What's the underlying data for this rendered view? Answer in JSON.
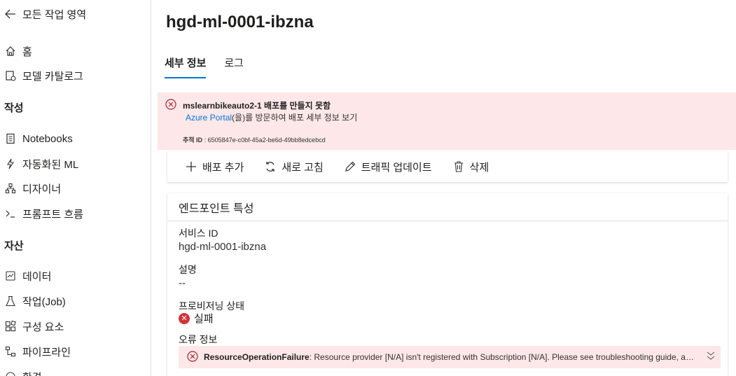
{
  "sidebar": {
    "back_label": "모든 작업 영역",
    "items_top": [
      {
        "label": "홈",
        "icon": "home-icon"
      },
      {
        "label": "모델 카탈로그",
        "icon": "model-catalog-icon"
      }
    ],
    "section_author": "작성",
    "items_author": [
      {
        "label": "Notebooks",
        "icon": "notebook-icon"
      },
      {
        "label": "자동화된 ML",
        "icon": "automl-icon"
      },
      {
        "label": "디자이너",
        "icon": "designer-icon"
      },
      {
        "label": "프롬프트 흐름",
        "icon": "prompt-flow-icon"
      }
    ],
    "section_assets": "자산",
    "items_assets": [
      {
        "label": "데이터",
        "icon": "data-icon"
      },
      {
        "label": "작업(Job)",
        "icon": "job-icon"
      },
      {
        "label": "구성 요소",
        "icon": "components-icon"
      },
      {
        "label": "파이프라인",
        "icon": "pipeline-icon"
      },
      {
        "label": "환경",
        "icon": "environment-icon"
      }
    ]
  },
  "main": {
    "title": "hgd-ml-0001-ibzna",
    "tabs": [
      {
        "label": "세부 정보",
        "active": true
      },
      {
        "label": "로그",
        "active": false
      }
    ],
    "error_banner": {
      "title": "mslearnbikeauto2-1 배포를 만들지 못함",
      "link_text": "Azure Portal",
      "line_suffix": "(을)를 방문하여 배포 세부 정보 보기",
      "trace_label": "추적 ID",
      "trace_value": " : 6505847e-c0bf-45a2-be6d-49bb8edcebcd"
    },
    "toolbar": {
      "add_label": "배포 추가",
      "refresh_label": "새로 고침",
      "traffic_label": "트래픽 업데이트",
      "delete_label": "삭제"
    },
    "card": {
      "header": "엔드포인트 특성",
      "service_id_label": "서비스 ID",
      "service_id_value": "hgd-ml-0001-ibzna",
      "description_label": "설명",
      "description_value": "--",
      "provisioning_label": "프로비저닝 상태",
      "provisioning_value": "실패",
      "error_info_label": "오류 정보",
      "error_code": "ResourceOperationFailure",
      "error_message": ": Resource provider [N/A] isn't registered with Subscription [N/A]. Please see troubleshooting guide, av..."
    }
  },
  "colors": {
    "accent": "#0078d4",
    "error_bg": "#fde7e9",
    "error_red": "#d13438"
  }
}
